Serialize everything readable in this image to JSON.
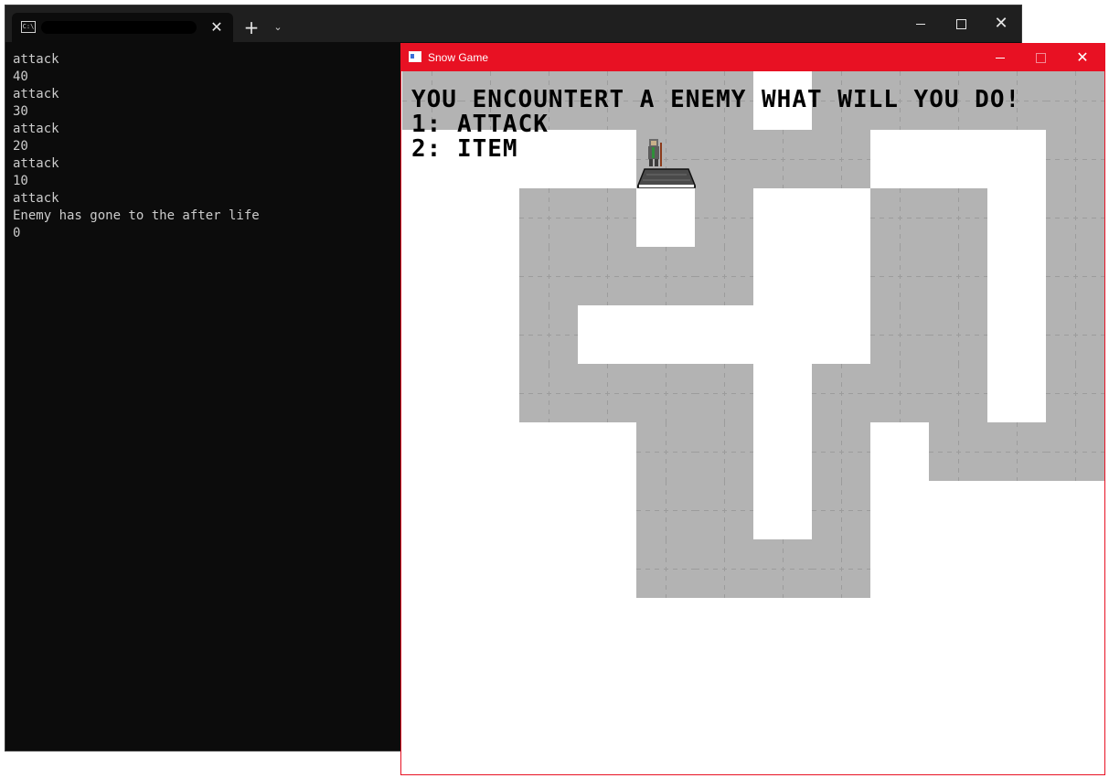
{
  "terminal": {
    "tab_icon_text": "C:\\",
    "tab_close_glyph": "✕",
    "new_tab_glyph": "+",
    "dropdown_glyph": "⌄",
    "close_glyph": "✕",
    "output_lines": [
      "attack",
      "40",
      "attack",
      "30",
      "attack",
      "20",
      "attack",
      "10",
      "attack",
      "Enemy has gone to the after life",
      "0"
    ]
  },
  "game_window": {
    "title": "Snow Game",
    "close_glyph": "✕",
    "hud": {
      "line1": "YOU ENCOUNTERT A ENEMY WHAT WILL YOU DO!",
      "line2": "1: ATTACK",
      "line3": "2: ITEM"
    },
    "colors": {
      "titlebar": "#e81123",
      "floor": "#b3b3b3",
      "snow": "#ffffff"
    },
    "map_rows": [
      "GGGGGGWGGGGG",
      "WWWWGGGGWWWG",
      "WWGGWGWWGGWG",
      "WWGGGGWWGGWG",
      "WWGWWWWWGGWG",
      "WWGGGGWGGGWG",
      "WWWWGGWGWGGG",
      "WWWWGGWGWWWW",
      "WWWWGGGGWWWW",
      "WWWWWWWWWWWW",
      "WWWWWWWWWWWW",
      "WWWWWWWWWWWW"
    ]
  }
}
